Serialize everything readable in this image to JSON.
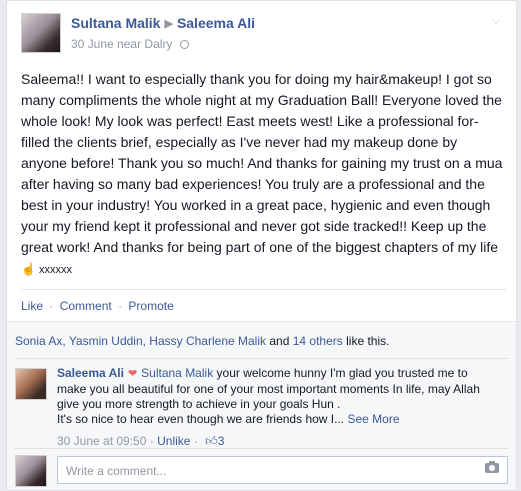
{
  "post": {
    "author": "Sultana Malik",
    "recipient": "Saleema Ali",
    "date": "30 June",
    "location_prefix": "near",
    "location": "Dalry",
    "message": "Saleema!! I want to especially thank you for doing my hair&makeup! I got so many compliments the whole night at my Graduation Ball! Everyone loved the whole look! My look was perfect! East meets west! Like a professional for-filled the clients brief, especially as I've never had my makeup done by anyone before! Thank you so much! And thanks for gaining my trust on a mua after having so many bad experiences! You truly are a professional and the best in your industry! You worked in a great pace, hygienic and even though your my friend kept it professional and never got side tracked!! Keep up the great work! And thanks for being part of one of the biggest chapters of my life",
    "message_emoji": "☝",
    "message_tail": " xxxxxx"
  },
  "actions": {
    "like": "Like",
    "comment": "Comment",
    "promote": "Promote",
    "separator": "·"
  },
  "likes": {
    "names": "Sonia Ax, Yasmin Uddin, Hassy Charlene Malik",
    "and": "and",
    "others": "14 others",
    "suffix": "like this."
  },
  "comment": {
    "author": "Saleema Ali",
    "mention": "Sultana Malik",
    "text": " your welcome hunny I'm glad you trusted me to make you all beautiful for one of your most important moments In life, may Allah give you more strength to achieve in your goals Hun .",
    "text2": "It's so nice to hear even though we are friends how I...",
    "see_more": "See More",
    "timestamp": "30 June at 09:50",
    "unlike": "Unlike",
    "like_count": "3"
  },
  "composer": {
    "placeholder": "Write a comment..."
  },
  "icons": {
    "chevron": "chevron-down-icon",
    "globe": "globe-icon",
    "heart": "heart-icon",
    "thumb": "thumbs-up-icon",
    "camera": "camera-icon"
  },
  "colors": {
    "link": "#3b5998",
    "meta": "#9197a3",
    "ufi_background": "#f6f7f8"
  }
}
